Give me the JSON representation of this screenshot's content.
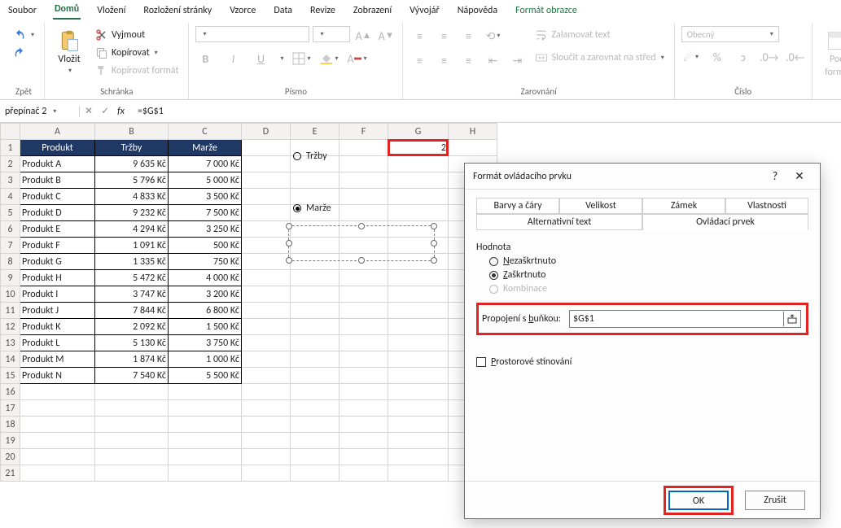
{
  "menuTabs": {
    "soubor": "Soubor",
    "domu": "Domů",
    "vlozeni": "Vložení",
    "rozvrzeni": "Rozložení stránky",
    "vzorce": "Vzorce",
    "data": "Data",
    "revize": "Revize",
    "zobrazeni": "Zobrazení",
    "vyvojar": "Vývojář",
    "napoveda": "Nápověda",
    "formatObrazce": "Formát obrazce"
  },
  "ribbon": {
    "undoGroup": "Zpět",
    "clipboard": {
      "paste": "Vložit",
      "cut": "Vyjmout",
      "copy": "Kopírovat",
      "formatPainter": "Kopírovat formát",
      "label": "Schránka"
    },
    "font": {
      "bold": "B",
      "italic": "I",
      "underline": "U",
      "label": "Písmo"
    },
    "alignment": {
      "wrap": "Zalamovat text",
      "merge": "Sloučit a zarovnat na střed",
      "label": "Zarovnání"
    },
    "number": {
      "general": "Obecný",
      "label": "Číslo"
    },
    "styles": {
      "cond": "Poc",
      "format": "forma"
    }
  },
  "nameBox": "přepínač 2",
  "formula": "=$G$1",
  "columns": [
    "A",
    "B",
    "C",
    "D",
    "E",
    "F",
    "G",
    "H"
  ],
  "headers": {
    "produkt": "Produkt",
    "trzby": "Tržby",
    "marze": "Marže"
  },
  "rows": [
    {
      "p": "Produkt A",
      "t": "9 635 Kč",
      "m": "7 000 Kč"
    },
    {
      "p": "Produkt B",
      "t": "5 796 Kč",
      "m": "5 000 Kč"
    },
    {
      "p": "Produkt C",
      "t": "4 833 Kč",
      "m": "3 500 Kč"
    },
    {
      "p": "Produkt D",
      "t": "9 232 Kč",
      "m": "7 500 Kč"
    },
    {
      "p": "Produkt E",
      "t": "4 294 Kč",
      "m": "3 250 Kč"
    },
    {
      "p": "Produkt F",
      "t": "1 091 Kč",
      "m": "500 Kč"
    },
    {
      "p": "Produkt G",
      "t": "1 335 Kč",
      "m": "750 Kč"
    },
    {
      "p": "Produkt H",
      "t": "5 472 Kč",
      "m": "4 000 Kč"
    },
    {
      "p": "Produkt I",
      "t": "3 747 Kč",
      "m": "3 200 Kč"
    },
    {
      "p": "Produkt J",
      "t": "7 844 Kč",
      "m": "6 800 Kč"
    },
    {
      "p": "Produkt K",
      "t": "2 092 Kč",
      "m": "1 500 Kč"
    },
    {
      "p": "Produkt L",
      "t": "5 130 Kč",
      "m": "3 750 Kč"
    },
    {
      "p": "Produkt M",
      "t": "1 874 Kč",
      "m": "1 000 Kč"
    },
    {
      "p": "Produkt N",
      "t": "7 540 Kč",
      "m": "5 500 Kč"
    }
  ],
  "g1value": "2",
  "radioTrzby": "Tržby",
  "radioMarze": "Marže",
  "dialog": {
    "title": "Formát ovládacího prvku",
    "tabs": {
      "barvy": "Barvy a čáry",
      "velikost": "Velikost",
      "zamek": "Zámek",
      "vlastnosti": "Vlastnosti",
      "altText": "Alternativní text",
      "ovladaci": "Ovládací prvek"
    },
    "hodnota": "Hodnota",
    "nezaskrtnuto": "Nezaškrtnuto",
    "zaskrtnuto": "Zaškrtnuto",
    "kombinace": "Kombinace",
    "propojeni": "Propojení s buňkou:",
    "propojeniVal": "$G$1",
    "stinovani": "Prostorové stínování",
    "ok": "OK",
    "zrusit": "Zrušit"
  }
}
